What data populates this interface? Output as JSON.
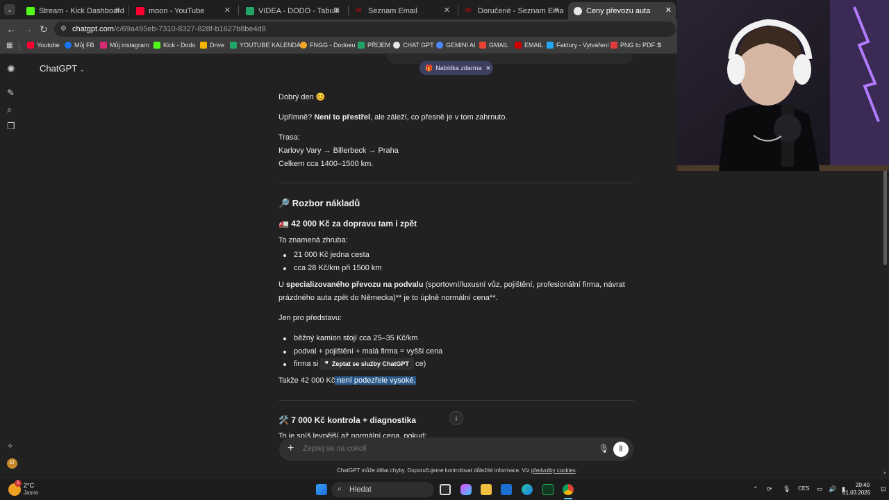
{
  "browser": {
    "tabs": [
      {
        "title": "Stream - Kick Dashboard",
        "color": "#53fc18"
      },
      {
        "title": "moon - YouTube",
        "color": "#ff0033"
      },
      {
        "title": "VIDEA - DODO - Tabulky Googl",
        "color": "#23a566"
      },
      {
        "title": "Seznam Email",
        "color": "#cc0000"
      },
      {
        "title": "Doručené - Seznam Email",
        "color": "#cc0000"
      },
      {
        "title": "Ceny převozu auta",
        "color": "#e8e8e8"
      }
    ],
    "url_host": "chatgpt.com",
    "url_path": "/c/69a495eb-7310-8327-828f-b1627b8be4d8",
    "bookmarks": [
      {
        "label": "Youtube",
        "color": "#ff0033"
      },
      {
        "label": "Můj FB",
        "color": "#1877f2"
      },
      {
        "label": "Můj instagram",
        "color": "#d62976"
      },
      {
        "label": "Kick - Dodo",
        "color": "#53fc18"
      },
      {
        "label": "Drive",
        "color": "#f4b400"
      },
      {
        "label": "YOUTUBE KALENDÁŘ",
        "color": "#23a566"
      },
      {
        "label": "FNGG - Dodoeu",
        "color": "#f5a623"
      },
      {
        "label": "PŘÍJEM",
        "color": "#23a566"
      },
      {
        "label": "CHAT GPT",
        "color": "#e8e8e8"
      },
      {
        "label": "GEMINI AI",
        "color": "#4b8bff"
      },
      {
        "label": "GMAIL",
        "color": "#ea4335"
      },
      {
        "label": "EMAIL",
        "color": "#cc0000"
      },
      {
        "label": "Faktury - Vytváření",
        "color": "#22a6f2"
      },
      {
        "label": "PNG to PDF",
        "color": "#e33b3b"
      },
      {
        "label": "S",
        "color": "#ffffff"
      }
    ]
  },
  "header": {
    "model": "ChatGPT"
  },
  "offer": {
    "label": "Nabídka zdarma"
  },
  "message": {
    "greeting": "Dobrý den 😊",
    "honest_prefix": "Upřímně? ",
    "honest_bold": "Není to přestřel",
    "honest_suffix": ", ale záleží, co přesně je v tom zahrnuto.",
    "route_label": "Trasa:",
    "route": "Karlovy Vary → Billerbeck → Praha",
    "total_distance": "Celkem cca 1400–1500 km.",
    "section_title": "🔎 Rozbor nákladů",
    "sub1_title": "🚛 42 000 Kč za dopravu tam i zpět",
    "means_roughly": "To znamená zhruba:",
    "bullets1": [
      "21 000 Kč jedna cesta",
      "cca 28 Kč/km při 1500 km"
    ],
    "spec_prefix": "U ",
    "spec_bold": "specializovaného převozu na podvalu",
    "spec_rest": " (sportovní/luxusní vůz, pojištění, profesionální firma, návrat",
    "spec_line2": "prázdného auta zpět do Německa)** je to úplně normální cena**.",
    "imagine": "Jen pro představu:",
    "bullets2": [
      "běžný kamion stojí cca 25–35 Kč/km",
      "podval + pojištění + malá firma = vyšší cena",
      "firma si",
      "ce)"
    ],
    "so_prefix": "Takže 42 000 Kč",
    "so_highlight": " není podezřele vysoké.",
    "sub2_title": "🛠️ 7 000 Kč kontrola + diagnostika",
    "cut_line": "To je spíš levnější až normální cena, pokud:"
  },
  "tooltip": {
    "label": "Zeptat se služby ChatGPT"
  },
  "composer": {
    "placeholder": "Zeptej se na cokoli"
  },
  "disclaimer": {
    "text": "ChatGPT může dělat chyby. Doporučujeme kontrolovat důležité informace. Viz ",
    "link": "předvolby cookies",
    "end": "."
  },
  "taskbar": {
    "weather_temp": "2°C",
    "weather_desc": "Jasno",
    "weather_badge": "1",
    "search": "Hledat",
    "lang": "CES",
    "time": "20:40",
    "date": "01.03.2026"
  }
}
